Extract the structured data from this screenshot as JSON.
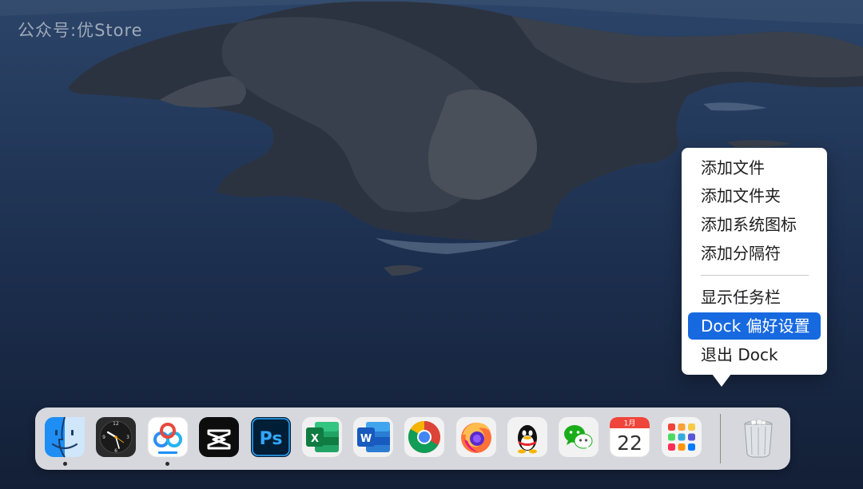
{
  "watermark": "公众号:优Store",
  "context_menu": {
    "items": [
      {
        "label": "添加文件",
        "highlighted": false
      },
      {
        "label": "添加文件夹",
        "highlighted": false
      },
      {
        "label": "添加系统图标",
        "highlighted": false
      },
      {
        "label": "添加分隔符",
        "highlighted": false
      },
      {
        "label": "显示任务栏",
        "highlighted": false
      },
      {
        "label": "Dock 偏好设置",
        "highlighted": true
      },
      {
        "label": "退出 Dock",
        "highlighted": false
      }
    ],
    "highlight_color": "#1769e0"
  },
  "dock": {
    "apps": [
      {
        "name": "Finder",
        "icon": "finder-icon",
        "running": true
      },
      {
        "name": "Clock",
        "icon": "clock-icon",
        "running": false
      },
      {
        "name": "Baidu Netdisk",
        "icon": "baidu-netdisk-icon",
        "running": true
      },
      {
        "name": "CapCut",
        "icon": "capcut-icon",
        "running": false
      },
      {
        "name": "Photoshop",
        "icon": "photoshop-icon",
        "running": false,
        "label": "Ps"
      },
      {
        "name": "Excel",
        "icon": "excel-icon",
        "running": false,
        "label": "X"
      },
      {
        "name": "Word",
        "icon": "word-icon",
        "running": false,
        "label": "W"
      },
      {
        "name": "Chrome",
        "icon": "chrome-icon",
        "running": false
      },
      {
        "name": "Firefox",
        "icon": "firefox-icon",
        "running": false
      },
      {
        "name": "QQ",
        "icon": "qq-icon",
        "running": false
      },
      {
        "name": "WeChat",
        "icon": "wechat-icon",
        "running": false
      },
      {
        "name": "Calendar",
        "icon": "calendar-icon",
        "running": false,
        "month": "1月",
        "day": "22"
      },
      {
        "name": "Launchpad",
        "icon": "launchpad-icon",
        "running": false
      }
    ],
    "trash": {
      "name": "Trash",
      "icon": "trash-icon"
    }
  }
}
